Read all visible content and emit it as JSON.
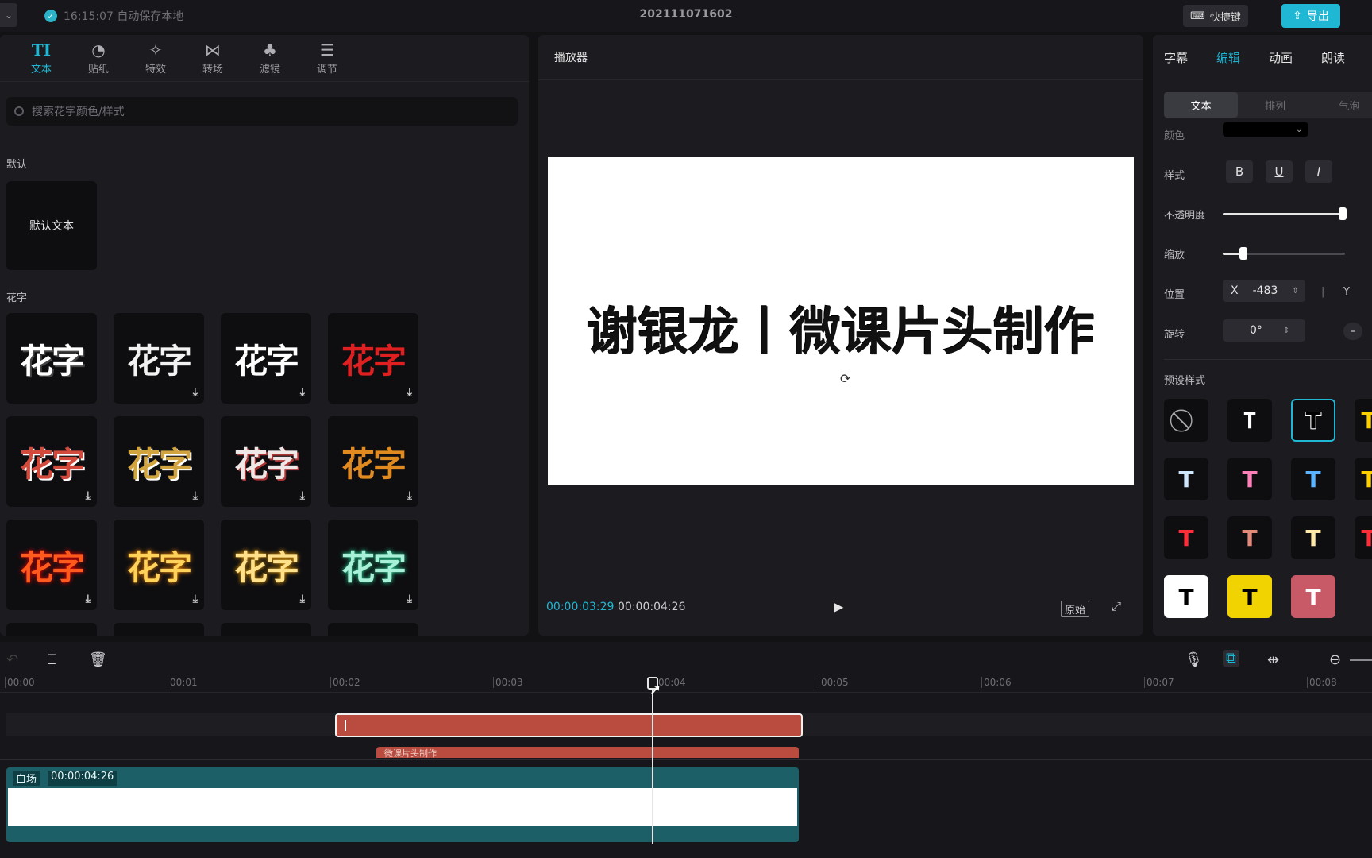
{
  "app": {
    "save_status": "16:15:07 自动保存本地",
    "project_title": "202111071602",
    "shortcut_label": "快捷键",
    "export_label": "导出",
    "accent": "#20b7d4"
  },
  "left_panel": {
    "tools": [
      {
        "label": "文本",
        "icon": "text-icon",
        "glyph": "TI"
      },
      {
        "label": "贴纸",
        "icon": "sticker-icon",
        "glyph": "◔"
      },
      {
        "label": "特效",
        "icon": "effects-icon",
        "glyph": "✧"
      },
      {
        "label": "转场",
        "icon": "transition-icon",
        "glyph": "⋈"
      },
      {
        "label": "滤镜",
        "icon": "filter-icon",
        "glyph": "♣"
      },
      {
        "label": "调节",
        "icon": "adjust-icon",
        "glyph": "☰"
      }
    ],
    "search_placeholder": "搜索花字颜色/样式",
    "default_section": "默认",
    "default_tile": "默认文本",
    "fancy_section": "花字",
    "fancy_tiles": [
      {
        "text": "花字",
        "color": "#ffffff"
      },
      {
        "text": "花字",
        "color": "#f2f2f2"
      },
      {
        "text": "花字",
        "color": "#ffffff"
      },
      {
        "text": "花字",
        "color": "#e02020"
      },
      {
        "text": "花字",
        "color": "#d24a3c"
      },
      {
        "text": "花字",
        "color": "#d2a440"
      },
      {
        "text": "花字",
        "color": "#efe6e6"
      },
      {
        "text": "花字",
        "color": "#e08a20"
      },
      {
        "text": "花字",
        "color": "#ff5a1e"
      },
      {
        "text": "花字",
        "color": "#ffd35a"
      },
      {
        "text": "花字",
        "color": "#ffe18c"
      },
      {
        "text": "花字",
        "color": "#a8f0d8"
      }
    ]
  },
  "player": {
    "title": "播放器",
    "canvas_text": "谢银龙丨微课片头制作",
    "current_time": "00:00:03:29",
    "total_time": "00:00:04:26",
    "original_label": "原始"
  },
  "right_panel": {
    "tabs": [
      "字幕",
      "编辑",
      "动画",
      "朗读"
    ],
    "active_tab": 1,
    "sub_tabs": [
      "文本",
      "排列",
      "气泡"
    ],
    "color_label": "颜色",
    "style_label": "样式",
    "opacity_label": "不透明度",
    "opacity_value": 0.98,
    "scale_label": "缩放",
    "scale_value": 0.17,
    "position_label": "位置",
    "pos_x_label": "X",
    "pos_x_value": "-483",
    "pos_y_label": "Y",
    "rotate_label": "旋转",
    "rotate_value": "0°",
    "preset_label": "预设样式"
  },
  "timeline": {
    "ruler": [
      "00:00",
      "00:01",
      "00:02",
      "00:03",
      "00:04",
      "00:05",
      "00:06",
      "00:07",
      "00:08"
    ],
    "clip2_label": "微课片头制作",
    "main_label": "白场",
    "main_duration": "00:00:04:26"
  }
}
